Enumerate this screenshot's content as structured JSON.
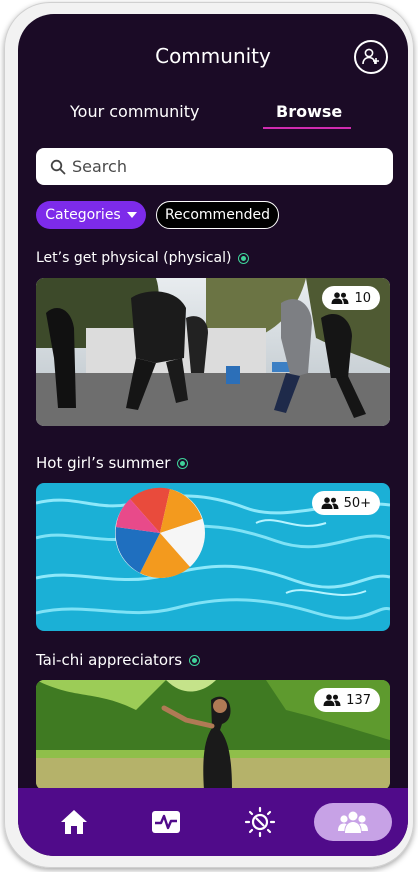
{
  "header": {
    "title": "Community",
    "add_friend_icon": "add-person-icon"
  },
  "tabs": [
    {
      "label": "Your community",
      "active": false
    },
    {
      "label": "Browse",
      "active": true
    }
  ],
  "search": {
    "placeholder": "Search",
    "icon": "search-icon"
  },
  "filters": [
    {
      "label": "Categories",
      "selected": true,
      "has_dropdown": true
    },
    {
      "label": "Recommended",
      "selected": false
    }
  ],
  "groups": [
    {
      "title": "Let’s get physical (physical)",
      "members": "10",
      "active": true,
      "image": "outdoor group running workout"
    },
    {
      "title": "Hot girl’s summer",
      "members": "50+",
      "active": true,
      "image": "beach ball floating in pool"
    },
    {
      "title": "Tai-chi appreciators",
      "members": "137",
      "active": true,
      "image": "woman practicing tai-chi in park"
    }
  ],
  "bottom_nav": [
    {
      "name": "home",
      "icon": "home-icon",
      "active": false
    },
    {
      "name": "activity",
      "icon": "heart-rate-icon",
      "active": false
    },
    {
      "name": "wellness",
      "icon": "sun-icon",
      "active": false
    },
    {
      "name": "community",
      "icon": "group-icon",
      "active": true
    }
  ],
  "colors": {
    "background": "#1b0b26",
    "accent": "#7d2bea",
    "tab_underline": "#d02bb0",
    "nav_bar": "#500b8a",
    "nav_active": "#c7a2e6",
    "active_indicator": "#3fd39a"
  }
}
